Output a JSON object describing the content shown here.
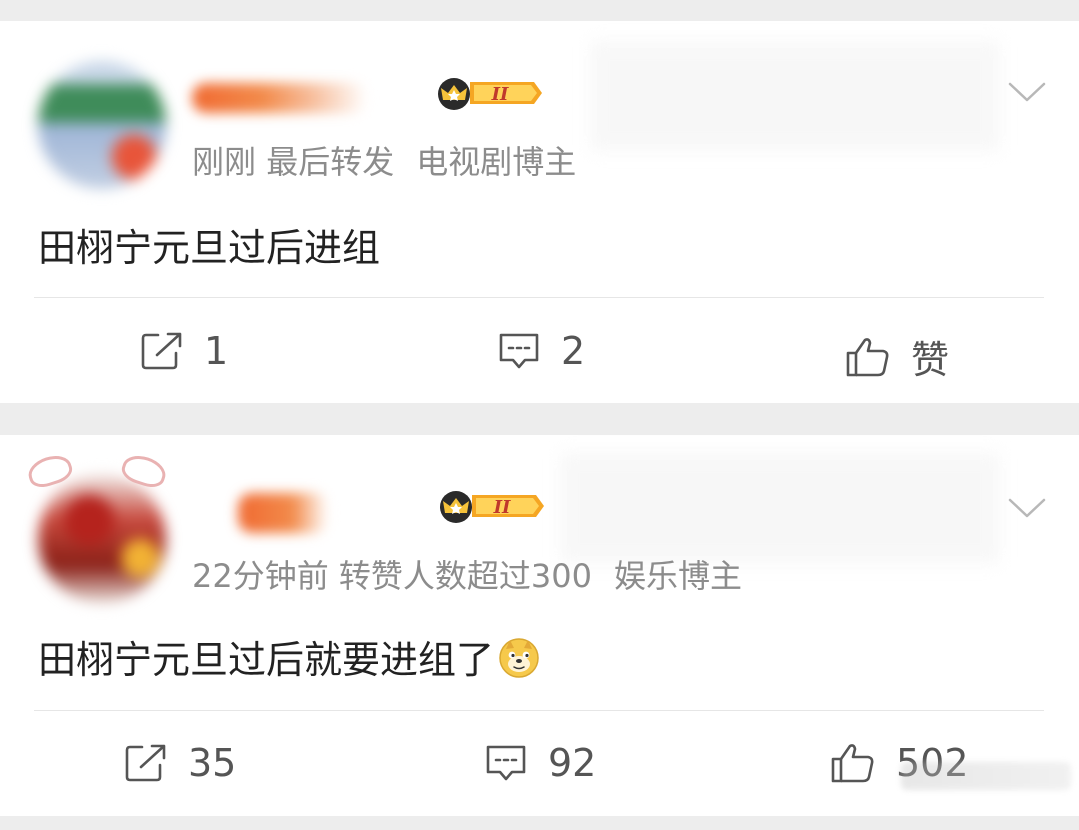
{
  "posts": [
    {
      "meta_time": "刚刚",
      "meta_extra": "最后转发",
      "meta_role": "电视剧博主",
      "badge_label": "II",
      "text": "田栩宁元旦过后进组",
      "repost_count": "1",
      "comment_count": "2",
      "like_label": "赞",
      "icons": [
        "repost-icon",
        "comment-icon",
        "like-icon",
        "chevron-down-icon",
        "crown-icon"
      ]
    },
    {
      "meta_time": "22分钟前",
      "meta_extra": "转赞人数超过300",
      "meta_role": "娱乐博主",
      "badge_label": "II",
      "text": "田栩宁元旦过后就要进组了",
      "emoji": "doge-emoji",
      "repost_count": "35",
      "comment_count": "92",
      "like_label": "502",
      "icons": [
        "repost-icon",
        "comment-icon",
        "like-icon",
        "chevron-down-icon",
        "crown-icon"
      ]
    }
  ],
  "colors": {
    "text": "#222222",
    "meta": "#8c8c8c",
    "action": "#555555",
    "badge": "#f5a623",
    "feed_bg": "#ededed"
  }
}
